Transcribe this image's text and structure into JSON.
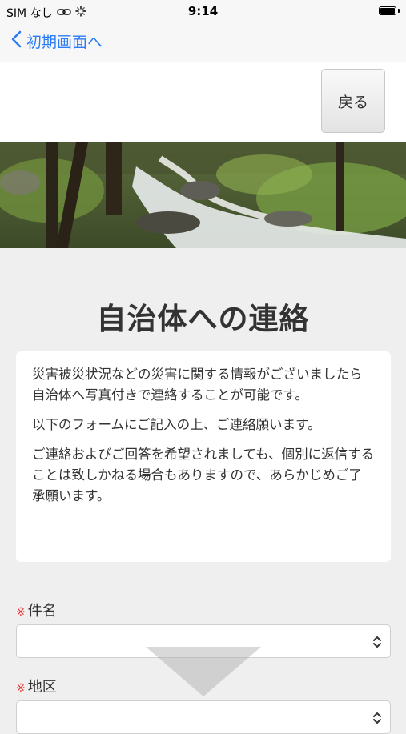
{
  "status_bar": {
    "carrier": "SIM なし",
    "time": "9:14"
  },
  "nav": {
    "back_label": "初期画面へ"
  },
  "header": {
    "return_button": "戻る"
  },
  "page": {
    "title": "自治体への連絡"
  },
  "info": {
    "paragraphs": [
      "災害被災状況などの災害に関する情報がございましたら自治体へ写真付きで連絡することが可能です。",
      "以下のフォームにご記入の上、ご連絡願います。",
      "ご連絡およびご回答を希望されましても、個別に返信することは致しかねる場合もありますので、あらかじめご了承願います。"
    ]
  },
  "form": {
    "required_mark": "※",
    "fields": [
      {
        "label": "件名",
        "value": ""
      },
      {
        "label": "地区",
        "value": ""
      }
    ]
  },
  "colors": {
    "accent": "#2b7cf6",
    "required": "#e53935"
  }
}
